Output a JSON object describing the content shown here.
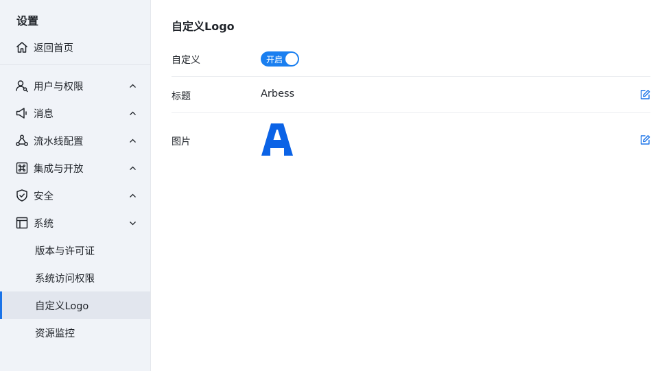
{
  "sidebar": {
    "title": "设置",
    "home": "返回首页",
    "items": [
      {
        "label": "用户与权限",
        "icon": "users-icon",
        "expanded": false
      },
      {
        "label": "消息",
        "icon": "megaphone-icon",
        "expanded": false
      },
      {
        "label": "流水线配置",
        "icon": "pipeline-icon",
        "expanded": false
      },
      {
        "label": "集成与开放",
        "icon": "command-icon",
        "expanded": false
      },
      {
        "label": "安全",
        "icon": "shield-icon",
        "expanded": false
      },
      {
        "label": "系统",
        "icon": "layout-icon",
        "expanded": true
      }
    ],
    "system_sub": [
      {
        "label": "版本与许可证"
      },
      {
        "label": "系统访问权限"
      },
      {
        "label": "自定义Logo",
        "active": true
      },
      {
        "label": "资源监控"
      }
    ]
  },
  "main": {
    "title": "自定义Logo",
    "custom_label": "自定义",
    "toggle_text": "开启",
    "title_label": "标题",
    "title_value": "Arbess",
    "image_label": "图片"
  },
  "colors": {
    "accent": "#1a73e8",
    "toggle": "#1a7ff0",
    "logo": "#0b63e6",
    "sidebar_bg": "#f0f3f8"
  }
}
